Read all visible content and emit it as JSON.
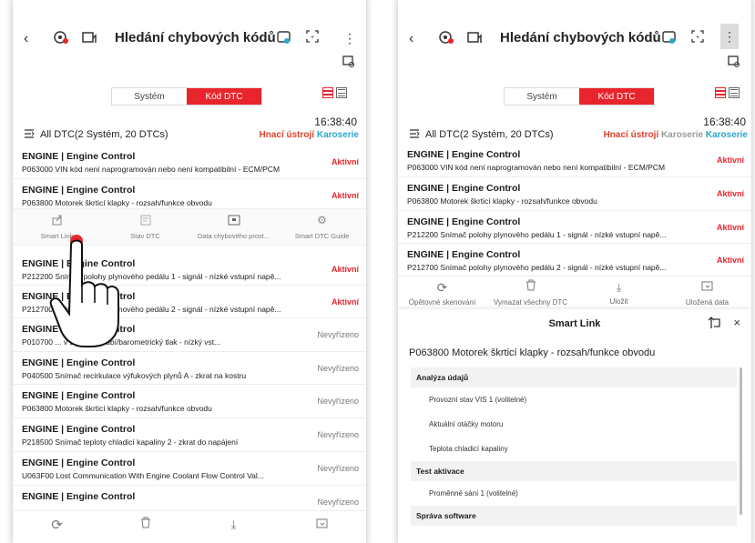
{
  "header": {
    "title": "Hledání chybových kódů"
  },
  "tabs": {
    "system": "Systém",
    "dtc": "Kód DTC"
  },
  "time": "16:38:40",
  "summary": {
    "text": "All DTC(2 Systém, 20 DTCs)",
    "cat1": "Hnací ústrojí",
    "cat2": "Karoserie",
    "cat3": "Karoserie"
  },
  "left_rows": [
    {
      "system": "ENGINE | Engine Control",
      "desc": "P063000 VIN kód není naprogramován nebo není kompatibilní - ECM/PCM",
      "status": "Aktivní"
    },
    {
      "system": "ENGINE | Engine Control",
      "desc": "P063800 Motorek škrticí klapky - rozsah/funkce obvodu",
      "status": "Aktivní"
    },
    {
      "system": "ENGINE | Engine Control",
      "desc": "P212200 Snímač polohy plynového pedálu 1 - signál - nízké vstupní napě...",
      "status": "Aktivní"
    },
    {
      "system": "ENGINE | Engine Control",
      "desc": "P212700 Snímač polohy plynového pedálu 2 - signál - nízké vstupní napě...",
      "status": "Aktivní"
    },
    {
      "system": "ENGINE | Engine Control",
      "desc": "P010700 ... v sacím potrubí/barometrický tlak - nízký vst...",
      "status": "Nevyřízeno"
    },
    {
      "system": "ENGINE | Engine Control",
      "desc": "P040500 Snímač recirkulace výfukových plynů A - zkrat na kostru",
      "status": "Nevyřízeno"
    },
    {
      "system": "ENGINE | Engine Control",
      "desc": "P063800 Motorek škrticí klapky - rozsah/funkce obvodu",
      "status": "Nevyřízeno"
    },
    {
      "system": "ENGINE | Engine Control",
      "desc": "P218500 Snímač teploty chladicí kapaliny 2 - zkrat do napájení",
      "status": "Nevyřízeno"
    },
    {
      "system": "ENGINE | Engine Control",
      "desc": "U063F00 Lost Communication With Engine Coolant Flow Control Val...",
      "status": "Nevyřízeno"
    },
    {
      "system": "ENGINE | Engine Control",
      "desc": "",
      "status": "Nevyřízeno"
    }
  ],
  "actions": [
    {
      "label": "Smart Link",
      "icon": "share-icon"
    },
    {
      "label": "Stav DTC",
      "icon": "status-icon"
    },
    {
      "label": "Data chybového prost...",
      "icon": "freeze-frame-icon"
    },
    {
      "label": "Smart DTC Guide",
      "icon": "gear-icon"
    }
  ],
  "right_rows": [
    {
      "system": "ENGINE | Engine Control",
      "desc": "P063000 VIN kód není naprogramován nebo není kompatibilní - ECM/PCM",
      "status": "Aktivní"
    },
    {
      "system": "ENGINE | Engine Control",
      "desc": "P063800 Motorek škrticí klapky - rozsah/funkce obvodu",
      "status": "Aktivní"
    },
    {
      "system": "ENGINE | Engine Control",
      "desc": "P212200 Snímač polohy plynového pedálu 1 - signál - nízké vstupní napě...",
      "status": "Aktivní"
    },
    {
      "system": "ENGINE | Engine Control",
      "desc": "P212700 Snímač polohy plynového pedálu 2 - signál - nízké vstupní napě...",
      "status": "Aktivní"
    }
  ],
  "bottom": {
    "rescan": "Opětovné skenování",
    "clear": "Vymazat všechny DTC",
    "save": "Uložit",
    "saved": "Uložená data"
  },
  "smart_link": {
    "title": "Smart Link",
    "dtc": "P063800 Motorek škrticí klapky - rozsah/funkce obvodu",
    "sections": [
      {
        "title": "Analýza údajů",
        "items": [
          "Provozní stav VIS 1 (volitelné)",
          "Aktuální otáčky motoru",
          "Teplota chladicí kapaliny"
        ]
      },
      {
        "title": "Test aktivace",
        "items": [
          "Proměnné sání 1 (volitelné)"
        ]
      },
      {
        "title": "Správa software",
        "items": []
      }
    ]
  }
}
